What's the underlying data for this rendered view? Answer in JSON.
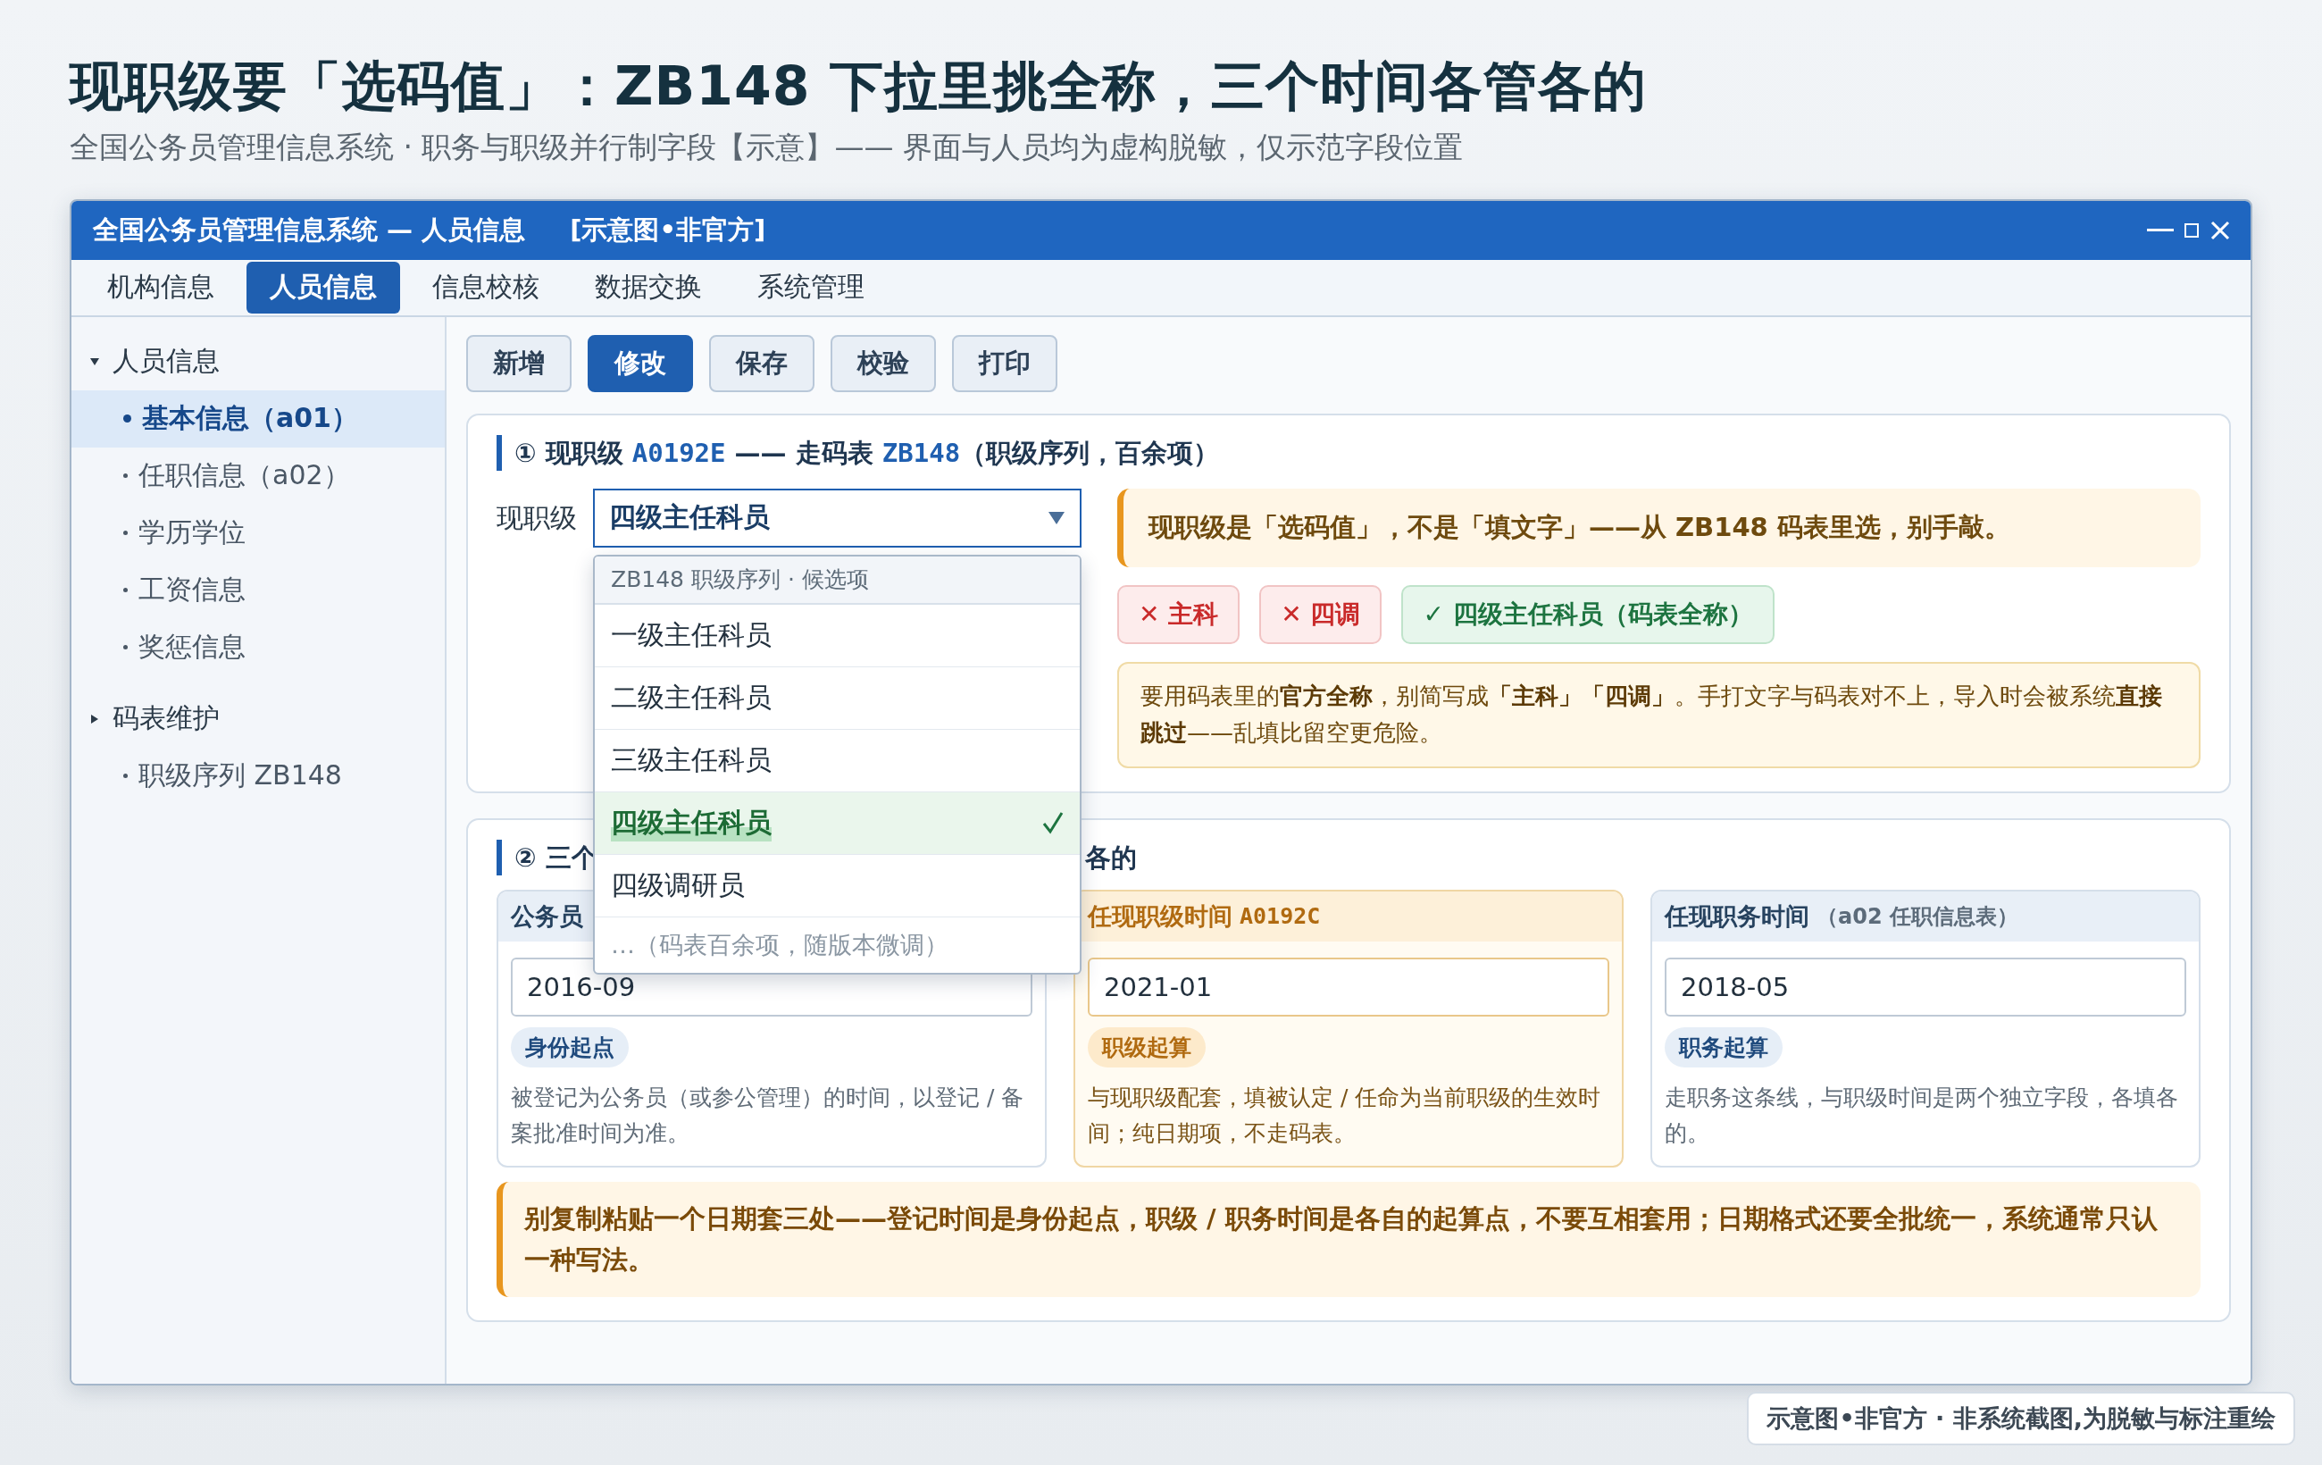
{
  "headline": "现职级要「选码值」：ZB148 下拉里挑全称，三个时间各管各的",
  "subheadline": "全国公务员管理信息系统 · 职务与职级并行制字段【示意】—— 界面与人员均为虚构脱敏，仅示范字段位置",
  "window": {
    "title": "全国公务员管理信息系统 — 人员信息",
    "tag": "[示意图•非官方]"
  },
  "menu_tabs": [
    {
      "label": "机构信息",
      "selected": false
    },
    {
      "label": "人员信息",
      "selected": true
    },
    {
      "label": "信息校核",
      "selected": false
    },
    {
      "label": "数据交换",
      "selected": false
    },
    {
      "label": "系统管理",
      "selected": false
    }
  ],
  "sidebar": [
    {
      "label": "人员信息",
      "expanded": true,
      "children": [
        {
          "label": "基本信息（a01）",
          "selected": true
        },
        {
          "label": "任职信息（a02）",
          "selected": false
        },
        {
          "label": "学历学位",
          "selected": false
        },
        {
          "label": "工资信息",
          "selected": false
        },
        {
          "label": "奖惩信息",
          "selected": false
        }
      ]
    },
    {
      "label": "码表维护",
      "expanded": false,
      "children": [
        {
          "label": "职级序列 ZB148",
          "selected": false
        }
      ]
    }
  ],
  "toolbar": [
    {
      "label": "新增",
      "selected": false
    },
    {
      "label": "修改",
      "selected": true
    },
    {
      "label": "保存",
      "selected": false
    },
    {
      "label": "校验",
      "selected": false
    },
    {
      "label": "打印",
      "selected": false
    }
  ],
  "section1": {
    "heading": [
      {
        "kind": "text",
        "text": "① 现职级 "
      },
      {
        "kind": "code",
        "text": "A0192E"
      },
      {
        "kind": "text",
        "text": " —— 走码表 "
      },
      {
        "kind": "code",
        "text": "ZB148"
      },
      {
        "kind": "text",
        "text": "（职级序列，百余项）"
      }
    ],
    "field_label": "现职级",
    "field_value": "四级主任科员",
    "dropdown": {
      "header": "ZB148 职级序列 · 候选项",
      "options": [
        {
          "label": "一级主任科员",
          "selected": false
        },
        {
          "label": "二级主任科员",
          "selected": false
        },
        {
          "label": "三级主任科员",
          "selected": false
        },
        {
          "label": "四级主任科员",
          "selected": true
        },
        {
          "label": "四级调研员",
          "selected": false
        }
      ],
      "more": "…（码表百余项，随版本微调）"
    },
    "note": "现职级是「选码值」，不是「填文字」——从 ZB148 码表里选，别手敲。",
    "examples": [
      {
        "kind": "wrong",
        "label": "✕ 主科"
      },
      {
        "kind": "wrong",
        "label": "✕ 四调"
      },
      {
        "kind": "right",
        "label": "✓ 四级主任科员（码表全称）"
      }
    ],
    "info": "要用码表里的**官方全称**，别简写成**「主科」「四调」**。手打文字与码表对不上，导入时会被系统**直接跳过**——乱填比留空更危险。"
  },
  "section2": {
    "title_left": "② 三个",
    "title_right": "各的",
    "cards": [
      {
        "kind": "plain",
        "title": "公务员",
        "value": "2016-09",
        "tag": "身份起点",
        "desc": "被登记为公务员（或参公管理）的时间，以登记 / 备案批准时间为准。"
      },
      {
        "kind": "accent",
        "title": "任现职级时间",
        "code": "A0192C",
        "value": "2021-01",
        "tag": "职级起算",
        "desc": "与现职级配套，填被认定 / 任命为当前职级的生效时间；纯日期项，不走码表。"
      },
      {
        "kind": "plain",
        "title": "任现职务时间",
        "sub": "（a02 任职信息表）",
        "value": "2018-05",
        "tag": "职务起算",
        "desc": "走职务这条线，与职级时间是两个独立字段，各填各的。"
      }
    ],
    "warning": "别复制粘贴一个日期套三处——登记时间是身份起点，职级 / 职务时间是各自的起算点，不要互相套用；日期格式还要全批统一，系统通常只认一种写法。"
  },
  "footer_badge": "示意图•非官方 · 非系统截图,为脱敏与标注重绘"
}
